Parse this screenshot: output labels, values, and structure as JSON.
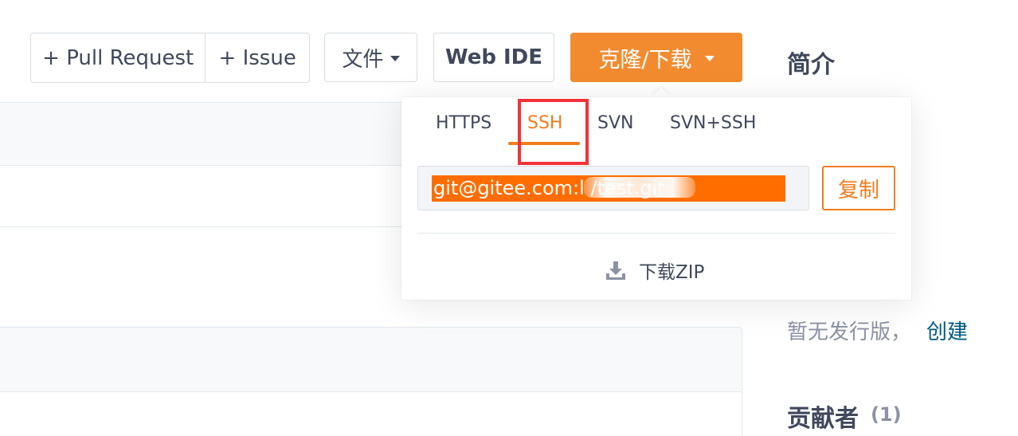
{
  "toolbar": {
    "pull_request_label": "+ Pull Request",
    "issue_label": "+ Issue",
    "files_label": "文件",
    "web_ide_label": "Web IDE",
    "clone_label": "克隆/下载"
  },
  "sidebar": {
    "intro_title": "简介",
    "release_text": "暂无发行版，",
    "release_link": "创建",
    "contributors_title": "贡献者",
    "contributors_count": "(1)"
  },
  "clone_popup": {
    "tabs": [
      {
        "label": "HTTPS",
        "active": false
      },
      {
        "label": "SSH",
        "active": true
      },
      {
        "label": "SVN",
        "active": false
      },
      {
        "label": "SVN+SSH",
        "active": false
      }
    ],
    "url_visible": "git@gitee.com:l           /test.git",
    "copy_label": "复制",
    "download_zip_label": "下载ZIP"
  },
  "colors": {
    "accent": "#f28b30",
    "active_tab": "#f27c1e",
    "highlight_box": "#f2323a",
    "link": "#005980"
  },
  "icons": {
    "files_dropdown": "caret-down-icon",
    "clone_dropdown": "caret-down-icon",
    "download": "download-icon"
  }
}
